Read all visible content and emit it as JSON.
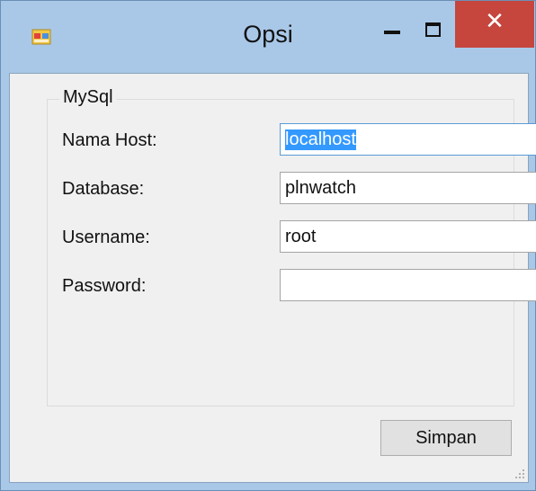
{
  "window": {
    "title": "Opsi",
    "close_glyph": "✕",
    "app_icon": "app-icon",
    "accent_close": "#c6453d"
  },
  "group": {
    "legend": "MySql",
    "fields": {
      "host_label": "Nama Host:",
      "host_value": "localhost",
      "database_label": "Database:",
      "database_value": "plnwatch",
      "username_label": "Username:",
      "username_value": "root",
      "password_label": "Password:",
      "password_value": ""
    }
  },
  "actions": {
    "save_label": "Simpan"
  }
}
